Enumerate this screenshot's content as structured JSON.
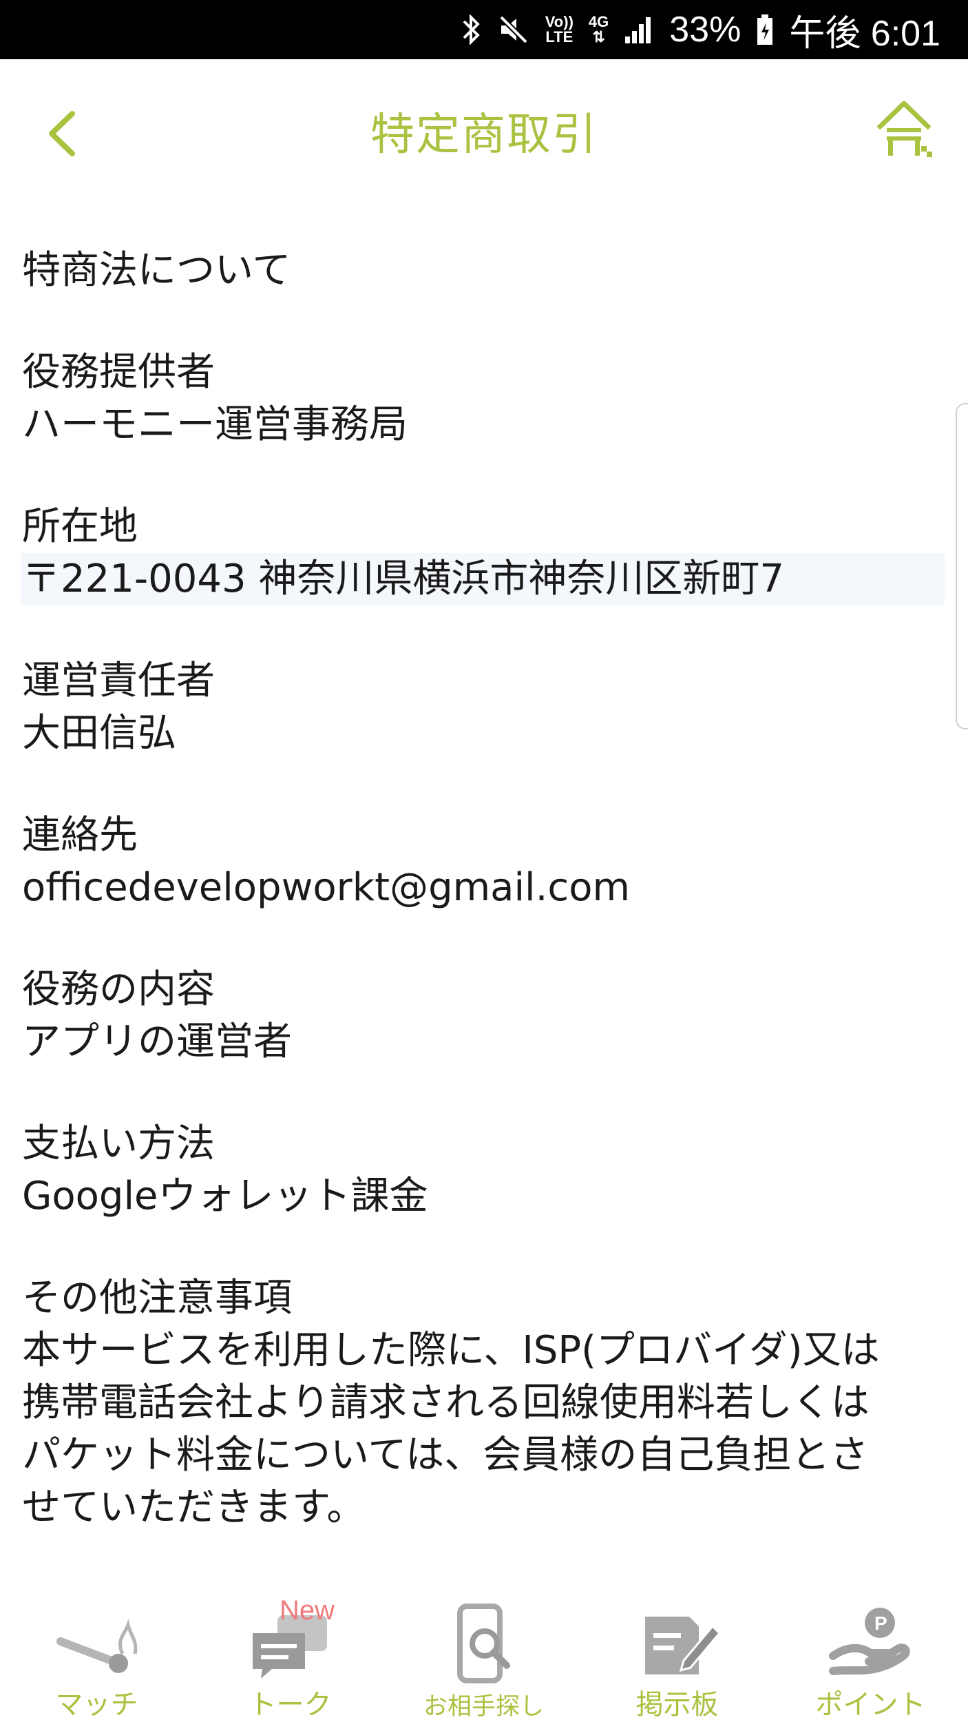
{
  "status_bar": {
    "volte_top": "Vo))",
    "volte_bottom": "LTE",
    "network_top": "4G",
    "battery_percent": "33%",
    "time": "午後 6:01"
  },
  "header": {
    "title": "特定商取引"
  },
  "content": {
    "heading": "特商法について",
    "sections": [
      {
        "label": "役務提供者",
        "value": "ハーモニー運営事務局"
      },
      {
        "label": "所在地",
        "value": "〒221-0043 神奈川県横浜市神奈川区新町7"
      },
      {
        "label": "運営責任者",
        "value": "大田信弘"
      },
      {
        "label": "連絡先",
        "value": "officedevelopworkt@gmail.com"
      },
      {
        "label": "役務の内容",
        "value": "アプリの運営者"
      },
      {
        "label": "支払い方法",
        "value": "Googleウォレット課金"
      }
    ],
    "notes_label": "その他注意事項",
    "notes_lines": [
      "本サービスを利用した際に、ISP(プロバイダ)又は",
      "携帯電話会社より請求される回線使用料若しくは",
      "パケット料金については、会員様の自己負担とさ",
      "せていただきます。"
    ]
  },
  "bottom_nav": {
    "items": [
      {
        "label": "マッチ",
        "icon": "match-icon"
      },
      {
        "label": "トーク",
        "icon": "talk-icon",
        "badge": "New"
      },
      {
        "label": "お相手探し",
        "icon": "search-partner-icon"
      },
      {
        "label": "掲示板",
        "icon": "board-icon"
      },
      {
        "label": "ポイント",
        "icon": "point-icon"
      }
    ]
  },
  "colors": {
    "accent": "#a9c23f",
    "icon_gray": "#9a9a9a",
    "badge": "#f07a7a",
    "status_bar": "#000000"
  }
}
